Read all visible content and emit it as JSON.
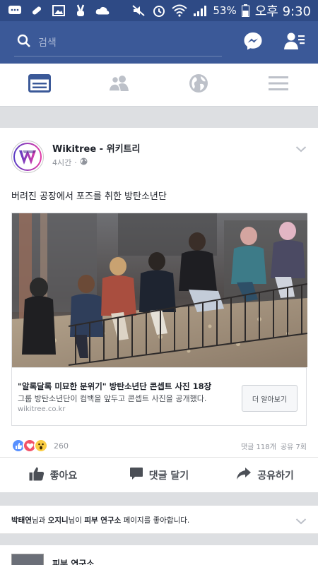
{
  "status_bar": {
    "battery": "53%",
    "time": "오후 9:30"
  },
  "search": {
    "placeholder": "검색"
  },
  "post": {
    "author": "Wikitree - 위키트리",
    "time_ago": "4시간",
    "dot": "·",
    "text": "버려진 공장에서 포즈를 취한 방탄소년단",
    "link": {
      "title": "\"알록달록 미묘한 분위기\" 방탄소년단 콘셉트 사진 18장",
      "description": "그룹 방탄소년단이 컴백을 앞두고 콘셉트 사진을 공개했다.",
      "domain": "wikitree.co.kr",
      "button_label": "더 알아보기"
    },
    "reaction_count": "260",
    "comments_count": "댓글 118개",
    "shares_count": "공유 7회",
    "actions": {
      "like": "좋아요",
      "comment": "댓글 달기",
      "share": "공유하기"
    }
  },
  "notice": {
    "user1": "박태연",
    "conj1": "님과 ",
    "user2": "오지니",
    "conj2": "님이 ",
    "page": "피부 연구소",
    "rest": " 페이지를 좋아합니다."
  },
  "post2": {
    "author": "피부 연구소"
  },
  "colors": {
    "brand_blue": "#3b5998",
    "status_bar": "#2e4a85",
    "like_blue": "#5890ff",
    "love_red": "#f25268",
    "wow_yellow": "#fbcd43"
  }
}
